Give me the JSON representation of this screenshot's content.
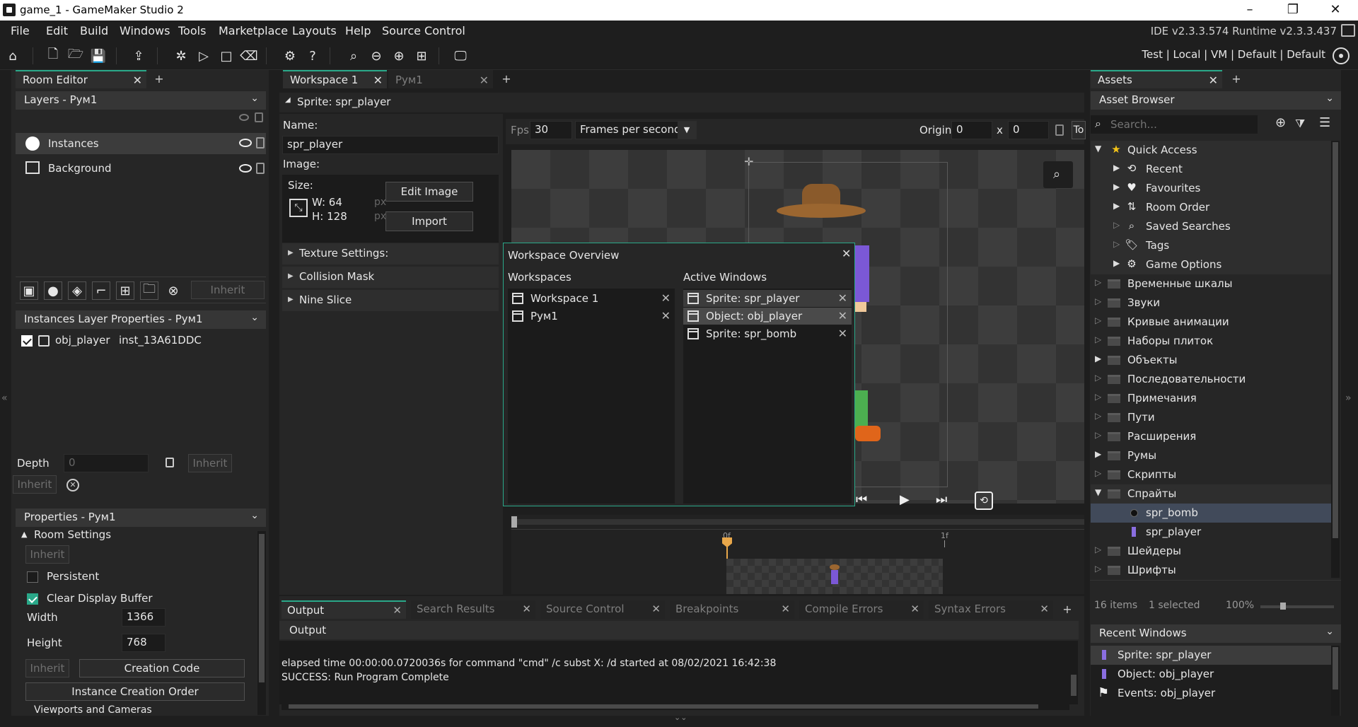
{
  "window": {
    "title": "game_1 - GameMaker Studio 2",
    "min": "–",
    "max": "❐",
    "close": "✕"
  },
  "menu": [
    "File",
    "Edit",
    "Build",
    "Windows",
    "Tools",
    "Marketplace",
    "Layouts",
    "Help",
    "Source Control"
  ],
  "ide_version": "IDE v2.3.3.574  Runtime v2.3.3.437",
  "target_bar": "Test | Local | VM | Default | Default",
  "left": {
    "tab": "Room Editor",
    "layers_title": "Layers - Рум1",
    "layers": [
      "Instances",
      "Background"
    ],
    "toolbar_inherit": "Inherit",
    "instances_title": "Instances Layer Properties - Рум1",
    "instance": {
      "object": "obj_player",
      "id": "inst_13A61DDC"
    },
    "depth_label": "Depth",
    "depth_value": "0",
    "inherit": "Inherit",
    "properties_title": "Properties - Рум1",
    "room_settings": "Room Settings",
    "persistent": "Persistent",
    "clear_display_buffer": "Clear Display Buffer",
    "width_label": "Width",
    "width_value": "1366",
    "height_label": "Height",
    "height_value": "768",
    "creation_code": "Creation Code",
    "instance_creation_order": "Instance Creation Order",
    "viewports": "Viewports and Cameras"
  },
  "center": {
    "tabs": [
      "Workspace 1",
      "Рум1"
    ],
    "sprite_title": "Sprite: spr_player",
    "name_label": "Name:",
    "name_value": "spr_player",
    "image_label": "Image:",
    "size_label": "Size:",
    "w": "W: 64",
    "h": "H: 128",
    "px": "px",
    "edit_image": "Edit Image",
    "import": "Import",
    "sections": [
      "Texture Settings:",
      "Collision Mask",
      "Nine Slice"
    ],
    "fps_label": "Fps",
    "fps_value": "30",
    "fps_mode": "Frames per second",
    "origin_label": "Origin",
    "origin_x": "0",
    "x_label": "x",
    "origin_y": "0",
    "to_label": "To",
    "frame_labels": [
      "0f",
      "1f"
    ]
  },
  "overview": {
    "title": "Workspace Overview",
    "workspaces_label": "Workspaces",
    "workspaces": [
      "Workspace 1",
      "Рум1"
    ],
    "active_label": "Active Windows",
    "active": [
      "Sprite: spr_player",
      "Object: obj_player",
      "Sprite: spr_bomb"
    ]
  },
  "assets": {
    "tab": "Assets",
    "browser": "Asset Browser",
    "search_placeholder": "Search...",
    "quick_access": "Quick Access",
    "quick_items": [
      "Recent",
      "Favourites",
      "Room Order",
      "Saved Searches",
      "Tags",
      "Game Options"
    ],
    "folders": [
      "Временные шкалы",
      "Звуки",
      "Кривые анимации",
      "Наборы плиток",
      "Объекты",
      "Последовательности",
      "Примечания",
      "Пути",
      "Расширения",
      "Румы",
      "Скрипты",
      "Спрайты"
    ],
    "sprites": [
      "spr_bomb",
      "spr_player"
    ],
    "more_folders": [
      "Шейдеры",
      "Шрифты"
    ],
    "status_items": "16 items",
    "status_selected": "1 selected",
    "zoom": "100%",
    "recent_title": "Recent Windows",
    "recent": [
      "Sprite: spr_player",
      "Object: obj_player",
      "Events: obj_player"
    ]
  },
  "output": {
    "tabs": [
      "Output",
      "Search Results",
      "Source Control",
      "Breakpoints",
      "Compile Errors",
      "Syntax Errors"
    ],
    "header": "Output",
    "lines": [
      "elapsed time 00:00:00.0720036s for command \"cmd\" /c subst X: /d started at 08/02/2021 16:42:38",
      "SUCCESS: Run Program Complete"
    ]
  }
}
